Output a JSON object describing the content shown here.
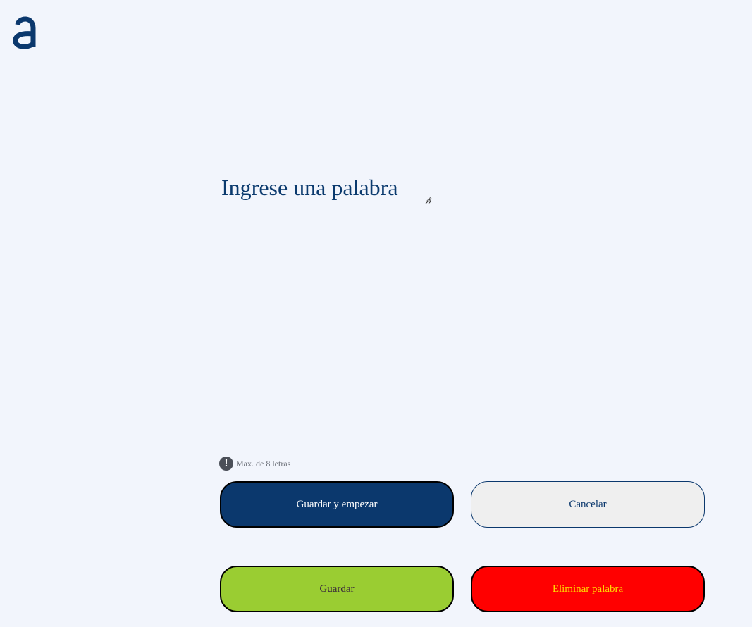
{
  "app": {
    "logo_icon": "a-logo-icon",
    "brand_color": "#0b386d"
  },
  "form": {
    "word_placeholder": "Ingrese una palabra",
    "word_value": "",
    "hint_icon": "exclamation-icon",
    "hint_text": "Max. de 8 letras"
  },
  "actions": {
    "start_label": "Guardar y empezar",
    "cancel_label": "Cancelar",
    "save_label": "Guardar",
    "delete_label": "Eliminar palabra"
  },
  "colors": {
    "background": "#f2f5fc",
    "primary": "#0b386d",
    "save": "#9acd32",
    "delete": "#ff0000",
    "delete_text": "#ffd700",
    "cancel": "#efefef"
  }
}
